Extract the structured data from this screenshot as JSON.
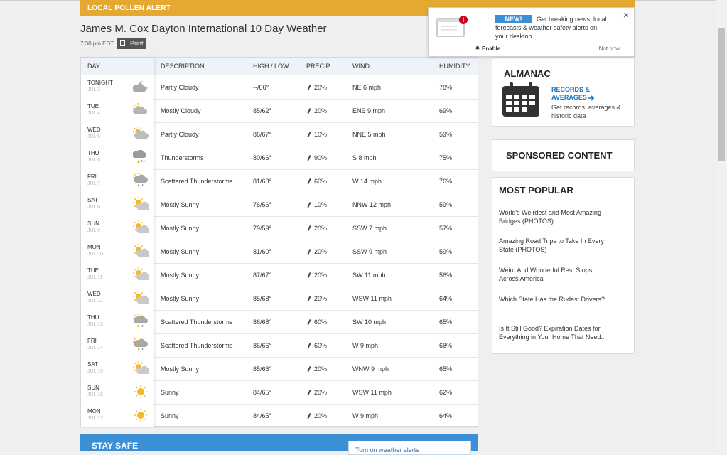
{
  "pollen_alert": "LOCAL POLLEN ALERT",
  "page_title": "James M. Cox Dayton International 10 Day Weather",
  "updated_time": "7:30 pm EDT",
  "print_label": "Print",
  "table": {
    "headers": {
      "day": "DAY",
      "description": "DESCRIPTION",
      "high_low": "HIGH / LOW",
      "precip": "PRECIP",
      "wind": "WIND",
      "humidity": "HUMIDITY"
    },
    "rows": [
      {
        "day": "TONIGHT",
        "date": "JUL 3",
        "icon": "night-partly-cloudy-icon",
        "desc": "Partly Cloudy",
        "hl": "--/66°",
        "precip": "20%",
        "wind": "NE 6 mph",
        "humidity": "78%"
      },
      {
        "day": "TUE",
        "date": "JUL 4",
        "icon": "mostly-cloudy-icon",
        "desc": "Mostly Cloudy",
        "hl": "85/62°",
        "precip": "20%",
        "wind": "ENE 9 mph",
        "humidity": "69%"
      },
      {
        "day": "WED",
        "date": "JUL 5",
        "icon": "partly-cloudy-icon",
        "desc": "Partly Cloudy",
        "hl": "86/67°",
        "precip": "10%",
        "wind": "NNE 5 mph",
        "humidity": "59%"
      },
      {
        "day": "THU",
        "date": "JUL 6",
        "icon": "thunderstorm-icon",
        "desc": "Thunderstorms",
        "hl": "80/66°",
        "precip": "90%",
        "wind": "S 8 mph",
        "humidity": "75%"
      },
      {
        "day": "FRI",
        "date": "JUL 7",
        "icon": "scattered-thunderstorm-icon",
        "desc": "Scattered Thunderstorms",
        "hl": "81/60°",
        "precip": "60%",
        "wind": "W 14 mph",
        "humidity": "76%"
      },
      {
        "day": "SAT",
        "date": "JUL 8",
        "icon": "mostly-sunny-icon",
        "desc": "Mostly Sunny",
        "hl": "76/56°",
        "precip": "10%",
        "wind": "NNW 12 mph",
        "humidity": "59%"
      },
      {
        "day": "SUN",
        "date": "JUL 9",
        "icon": "mostly-sunny-icon",
        "desc": "Mostly Sunny",
        "hl": "79/59°",
        "precip": "20%",
        "wind": "SSW 7 mph",
        "humidity": "57%"
      },
      {
        "day": "MON",
        "date": "JUL 10",
        "icon": "mostly-sunny-icon",
        "desc": "Mostly Sunny",
        "hl": "81/60°",
        "precip": "20%",
        "wind": "SSW 9 mph",
        "humidity": "59%"
      },
      {
        "day": "TUE",
        "date": "JUL 11",
        "icon": "mostly-sunny-icon",
        "desc": "Mostly Sunny",
        "hl": "87/67°",
        "precip": "20%",
        "wind": "SW 11 mph",
        "humidity": "56%"
      },
      {
        "day": "WED",
        "date": "JUL 12",
        "icon": "mostly-sunny-icon",
        "desc": "Mostly Sunny",
        "hl": "85/68°",
        "precip": "20%",
        "wind": "WSW 11 mph",
        "humidity": "64%"
      },
      {
        "day": "THU",
        "date": "JUL 13",
        "icon": "scattered-thunderstorm-icon",
        "desc": "Scattered Thunderstorms",
        "hl": "86/68°",
        "precip": "60%",
        "wind": "SW 10 mph",
        "humidity": "65%"
      },
      {
        "day": "FRI",
        "date": "JUL 14",
        "icon": "scattered-thunderstorm-icon",
        "desc": "Scattered Thunderstorms",
        "hl": "86/66°",
        "precip": "60%",
        "wind": "W 9 mph",
        "humidity": "68%"
      },
      {
        "day": "SAT",
        "date": "JUL 15",
        "icon": "mostly-sunny-icon",
        "desc": "Mostly Sunny",
        "hl": "85/66°",
        "precip": "20%",
        "wind": "WNW 9 mph",
        "humidity": "65%"
      },
      {
        "day": "SUN",
        "date": "JUL 16",
        "icon": "sunny-icon",
        "desc": "Sunny",
        "hl": "84/65°",
        "precip": "20%",
        "wind": "WSW 11 mph",
        "humidity": "62%"
      },
      {
        "day": "MON",
        "date": "JUL 17",
        "icon": "sunny-icon",
        "desc": "Sunny",
        "hl": "84/65°",
        "precip": "20%",
        "wind": "W 9 mph",
        "humidity": "64%"
      }
    ]
  },
  "stay_safe": {
    "title": "STAY SAFE",
    "alert_text": "Turn on weather alerts"
  },
  "almanac": {
    "title": "ALMANAC",
    "link": "RECORDS & AVERAGES",
    "description": "Get records, averages & historic data"
  },
  "sponsored": "SPONSORED CONTENT",
  "most_popular": {
    "title": "MOST POPULAR",
    "items": [
      "World's Weirdest and Most Amazing Bridges (PHOTOS)",
      "Amazing Road Trips to Take In Every State (PHOTOS)",
      "Weird And Wonderful Rest Stops Across America",
      "Which State Has the Rudest Drivers?",
      "Is It Still Good? Expiration Dates for Everything in Your Home That Need..."
    ]
  },
  "popup": {
    "badge": "NEW!",
    "message": "Get breaking news, local forecasts & weather safety alerts on your desktop.",
    "enable": "Enable",
    "not_now": "Not now",
    "close": "×"
  },
  "colors": {
    "pollen": "#e5a831",
    "accent_blue": "#3b8fd4",
    "link_blue": "#1a73c6",
    "sun": "#f4b82a"
  }
}
